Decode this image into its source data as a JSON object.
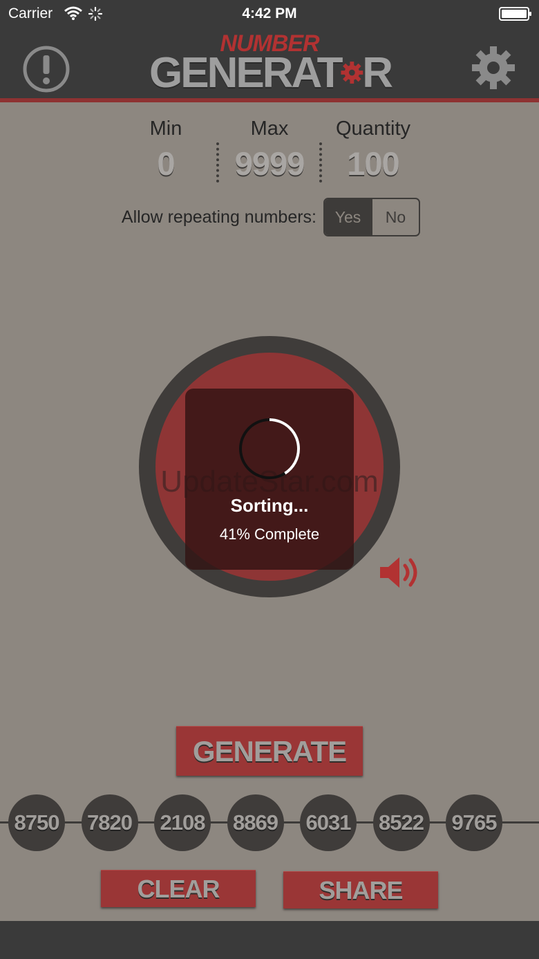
{
  "status_bar": {
    "carrier": "Carrier",
    "time": "4:42 PM"
  },
  "header": {
    "logo_top": "NUMBER",
    "logo_main_left": "GENERAT",
    "logo_main_right": "R"
  },
  "settings": {
    "min": {
      "label": "Min",
      "value": "0"
    },
    "max": {
      "label": "Max",
      "value": "9999"
    },
    "quantity": {
      "label": "Quantity",
      "value": "100"
    }
  },
  "repeat": {
    "label": "Allow repeating numbers:",
    "yes": "Yes",
    "no": "No",
    "selected": "Yes"
  },
  "watermark": "UpdateStar.com",
  "hud": {
    "title": "Sorting...",
    "progress_text": "41% Complete",
    "progress": 0.41
  },
  "buttons": {
    "generate": "GENERATE",
    "clear": "CLEAR",
    "share": "SHARE"
  },
  "results": [
    "8750",
    "7820",
    "2108",
    "8869",
    "6031",
    "8522",
    "9765"
  ],
  "colors": {
    "accent": "#8e3535",
    "background": "#8d8780",
    "header": "#3a3a3a"
  }
}
